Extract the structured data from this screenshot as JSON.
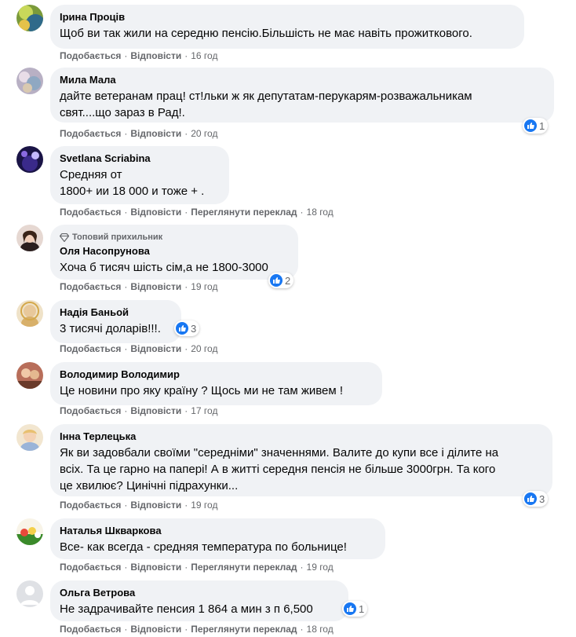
{
  "labels": {
    "like": "Подобається",
    "reply": "Відповісти",
    "see_translation": "Переглянути переклад",
    "top_fan": "Топовий прихильник"
  },
  "comments": [
    {
      "name": "Ірина Проців",
      "text": "Щоб ви так жили на середню пенсію.Більшість не має навіть прожиткового.",
      "time": "16 год",
      "reactions": null
    },
    {
      "name": "Мила Мала",
      "text": "дайте ветеранам прац! ст!льки ж як депутатам-перукарям-розважальникам\nсвят....що зараз в Рад!.",
      "time": "20 год",
      "reactions": "1"
    },
    {
      "name": "Svetlana Scriabina",
      "text": "Средняя от\n1800+ ии 18 000 и тоже + .",
      "time": "18 год",
      "reactions": null
    },
    {
      "name": "Оля Насопрунова",
      "text": "Хоча б тисяч шість сім,а не 1800-3000",
      "time": "19 год",
      "reactions": "2"
    },
    {
      "name": "Надія Баньой",
      "text": "3 тисячі доларів!!!.",
      "time": "20 год",
      "reactions": "3"
    },
    {
      "name": "Володимир Володимир",
      "text": "Це новини про яку країну ? Щось ми не там живем !",
      "time": "17 год",
      "reactions": null
    },
    {
      "name": "Інна Терлецька",
      "text": "Як ви задовбали своїми \"середніми\" значеннями. Валите до купи все і ділите на\nвсіх. Та це гарно на папері! А в житті середня пенсія не більше 3000грн. Та кого\nце хвилює? Цинічні підрахунки...",
      "time": "19 год",
      "reactions": "3"
    },
    {
      "name": "Наталья Шкваркова",
      "text": "Все- как всегда - средняя температура по больнице!",
      "time": "19 год",
      "reactions": null
    },
    {
      "name": "Ольга Ветрова",
      "text": "Не задрачивайте пенсия 1 864 а мин з п 6,500",
      "time": "18 год",
      "reactions": "1"
    }
  ],
  "colors": {
    "bubble": "#f0f2f5",
    "like_blue": "#1877f2",
    "muted": "#65676b"
  },
  "icons": {
    "top_fan_badge": "diamond-icon",
    "like_reaction": "thumbs-up-icon"
  }
}
